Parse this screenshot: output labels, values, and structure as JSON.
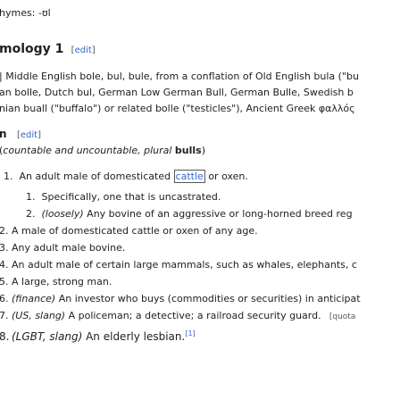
{
  "rhymes": {
    "label": "hymes:",
    "value": "-ʊl"
  },
  "etym_heading": {
    "title": "mology 1",
    "edit": "edit"
  },
  "etym_lines": [
    "| Middle English bole, bul, bule, from a conflation of Old English bula (\"bu",
    "an bolle, Dutch bul, German Low German Bull, German Bulle, Swedish b",
    "nian buall (\"buffalo\") or related bolle (\"testicles\"), Ancient Greek φαλλός"
  ],
  "noun_heading": {
    "title": "n",
    "edit": "edit"
  },
  "noun_line": {
    "pre": "(",
    "italic": "countable and uncountable, plural",
    "bold": "bulls",
    "post": ")"
  },
  "senses": [
    {
      "num": "1.",
      "pre": "An adult male of domesticated ",
      "link": "cattle",
      "post": " or oxen."
    },
    {
      "num": "1.",
      "text": "Specifically, one that is uncastrated."
    },
    {
      "num": "2.",
      "label": "(loosely)",
      "text": " Any bovine of an aggressive or long-horned breed reg"
    },
    {
      "num": "2.",
      "text": "A male of domesticated cattle or oxen of any age."
    },
    {
      "num": "3.",
      "text": "Any adult male bovine."
    },
    {
      "num": "4.",
      "text": "An adult male of certain large mammals, such as whales, elephants, c"
    },
    {
      "num": "5.",
      "text": "A large, strong man."
    },
    {
      "num": "6.",
      "label": "(finance)",
      "text": " An investor who buys (commodities or securities) in anticipat"
    },
    {
      "num": "7.",
      "label": "(US, slang)",
      "text": " A policeman; a detective; a railroad security guard.",
      "quote": "[quota"
    },
    {
      "num": "8.",
      "label": "(LGBT, slang)",
      "text": " An elderly lesbian.",
      "ref": "[1]"
    }
  ]
}
